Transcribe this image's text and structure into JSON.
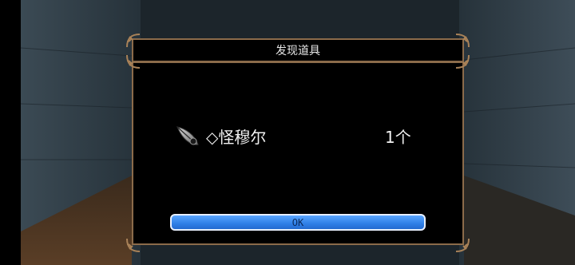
{
  "dialog": {
    "title": "发现道具",
    "item": {
      "icon": "feather-quill-icon",
      "name": "◇怪穆尔",
      "count": "1个"
    },
    "ok_label": "OK"
  },
  "colors": {
    "frame_gold": "#8b6b4a",
    "button_blue": "#2f7fe6",
    "dialog_bg": "#000000"
  }
}
